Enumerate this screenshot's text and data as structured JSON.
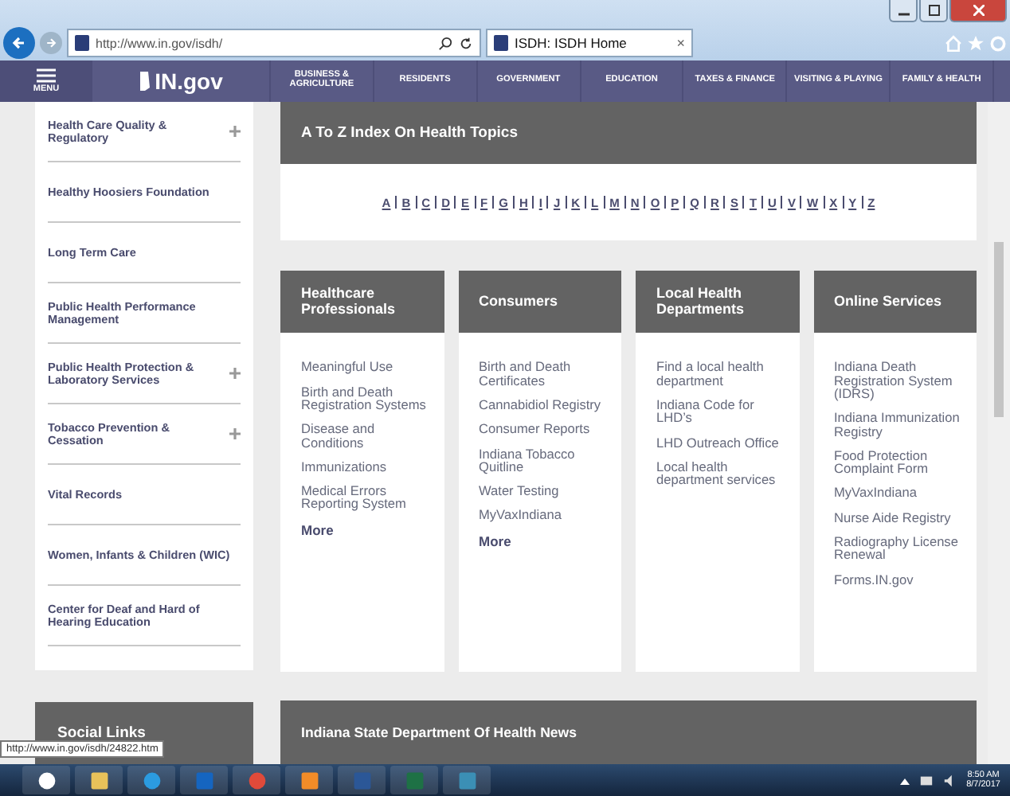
{
  "browser": {
    "address": "http://www.in.gov/isdh/",
    "tab_title": "ISDH: ISDH Home",
    "tab_close": "×"
  },
  "nav": {
    "menu_label": "MENU",
    "logo": "IN.gov",
    "items": [
      "BUSINESS & AGRICULTURE",
      "RESIDENTS",
      "GOVERNMENT",
      "EDUCATION",
      "TAXES & FINANCE",
      "VISITING & PLAYING",
      "FAMILY & HEALTH"
    ]
  },
  "sidebar": {
    "items": [
      {
        "label": "Health Care Quality & Regulatory",
        "expandable": true
      },
      {
        "label": "Healthy Hoosiers Foundation",
        "expandable": false
      },
      {
        "label": "Long Term Care",
        "expandable": false
      },
      {
        "label": "Public Health Performance Management",
        "expandable": false
      },
      {
        "label": "Public Health Protection & Laboratory Services",
        "expandable": true
      },
      {
        "label": "Tobacco Prevention & Cessation",
        "expandable": true
      },
      {
        "label": "Vital Records",
        "expandable": false
      },
      {
        "label": "Women, Infants & Children (WIC)",
        "expandable": false
      },
      {
        "label": "Center for Deaf and Hard of Hearing Education",
        "expandable": false
      }
    ],
    "social_title": "Social Links"
  },
  "az_index": {
    "title": "A To Z Index On Health Topics",
    "letters": [
      "A",
      "B",
      "C",
      "D",
      "E",
      "F",
      "G",
      "H",
      "I",
      "J",
      "K",
      "L",
      "M",
      "N",
      "O",
      "P",
      "Q",
      "R",
      "S",
      "T",
      "U",
      "V",
      "W",
      "X",
      "Y",
      "Z"
    ]
  },
  "cards": [
    {
      "title": "Healthcare Professionals",
      "links": [
        "Meaningful Use",
        "Birth and Death Registration Systems",
        "Disease and Conditions",
        "Immunizations",
        "Medical Errors Reporting System"
      ],
      "more": "More"
    },
    {
      "title": "Consumers",
      "links": [
        "Birth and Death Certificates",
        "Cannabidiol Registry",
        "Consumer Reports",
        "Indiana Tobacco Quitline",
        "Water Testing",
        "MyVaxIndiana"
      ],
      "more": "More"
    },
    {
      "title": "Local Health Departments",
      "links": [
        "Find a local health department",
        "Indiana Code for LHD’s",
        "LHD Outreach Office",
        "Local health department services"
      ]
    },
    {
      "title": "Online Services",
      "links": [
        "Indiana Death Registration System (IDRS)",
        "Indiana Immunization Registry",
        "Food Protection Complaint Form",
        "MyVaxIndiana",
        "Nurse Aide Registry",
        "Radiography License Renewal",
        "Forms.IN.gov"
      ]
    }
  ],
  "news_title": "Indiana State Department Of Health News",
  "status_url": "http://www.in.gov/isdh/24822.htm",
  "taskbar": {
    "time": "8:50 AM",
    "date": "8/7/2017"
  }
}
